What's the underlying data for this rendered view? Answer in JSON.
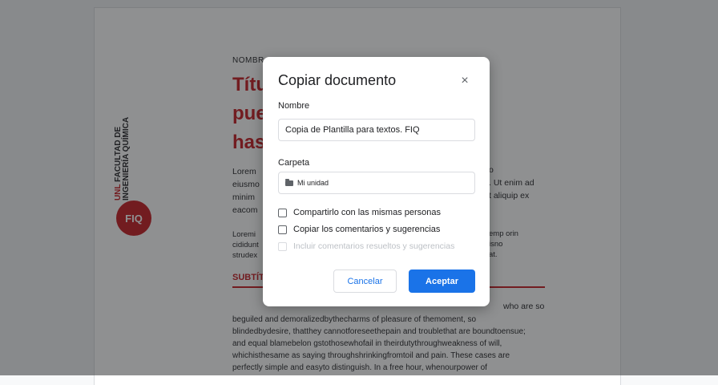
{
  "document": {
    "field_label": "NOMBR",
    "title_lines": [
      "Títu",
      "pue",
      "has"
    ],
    "brand_prefix": "UNL",
    "brand_line1": "FACULTAD DE",
    "brand_line2": "INGENIERÍA QUÍMICA",
    "brand_badge": "FIQ",
    "para1_left": [
      "Lorem",
      "eiusmo",
      "minim",
      "eacom"
    ],
    "para1_right": [
      "o",
      ". Ut enim ad",
      "t aliquip ex"
    ],
    "para2_left": [
      "Loremi",
      "cididunt",
      "strudex"
    ],
    "para2_right": [
      "emp orin",
      "isno",
      "at."
    ],
    "subtitle": "SUBTÍT",
    "body_right_top": "who are so",
    "body_lines": [
      "beguiled and demoralizedbythecharms of pleasure of themoment, so",
      "blindedbydesire, thatthey cannotforeseethepain and troublethat are boundtoensue;",
      "and equal blamebelon gstothosewhofail in theirdutythroughweakness of will,",
      "whichisthesame as saying throughshrinkingfromtoil and pain. These cases are",
      "perfectly simple and easyto distinguish. In a free hour, whenourpower of"
    ]
  },
  "dialog": {
    "title": "Copiar documento",
    "name_label": "Nombre",
    "name_value": "Copia de Plantilla para textos. FIQ",
    "folder_label": "Carpeta",
    "folder_value": "Mi unidad",
    "share_label": "Compartirlo con las mismas personas",
    "copy_comments_label": "Copiar los comentarios y sugerencias",
    "include_resolved_label": "Incluir comentarios resueltos y sugerencias",
    "cancel_label": "Cancelar",
    "accept_label": "Aceptar",
    "close_glyph": "×"
  }
}
